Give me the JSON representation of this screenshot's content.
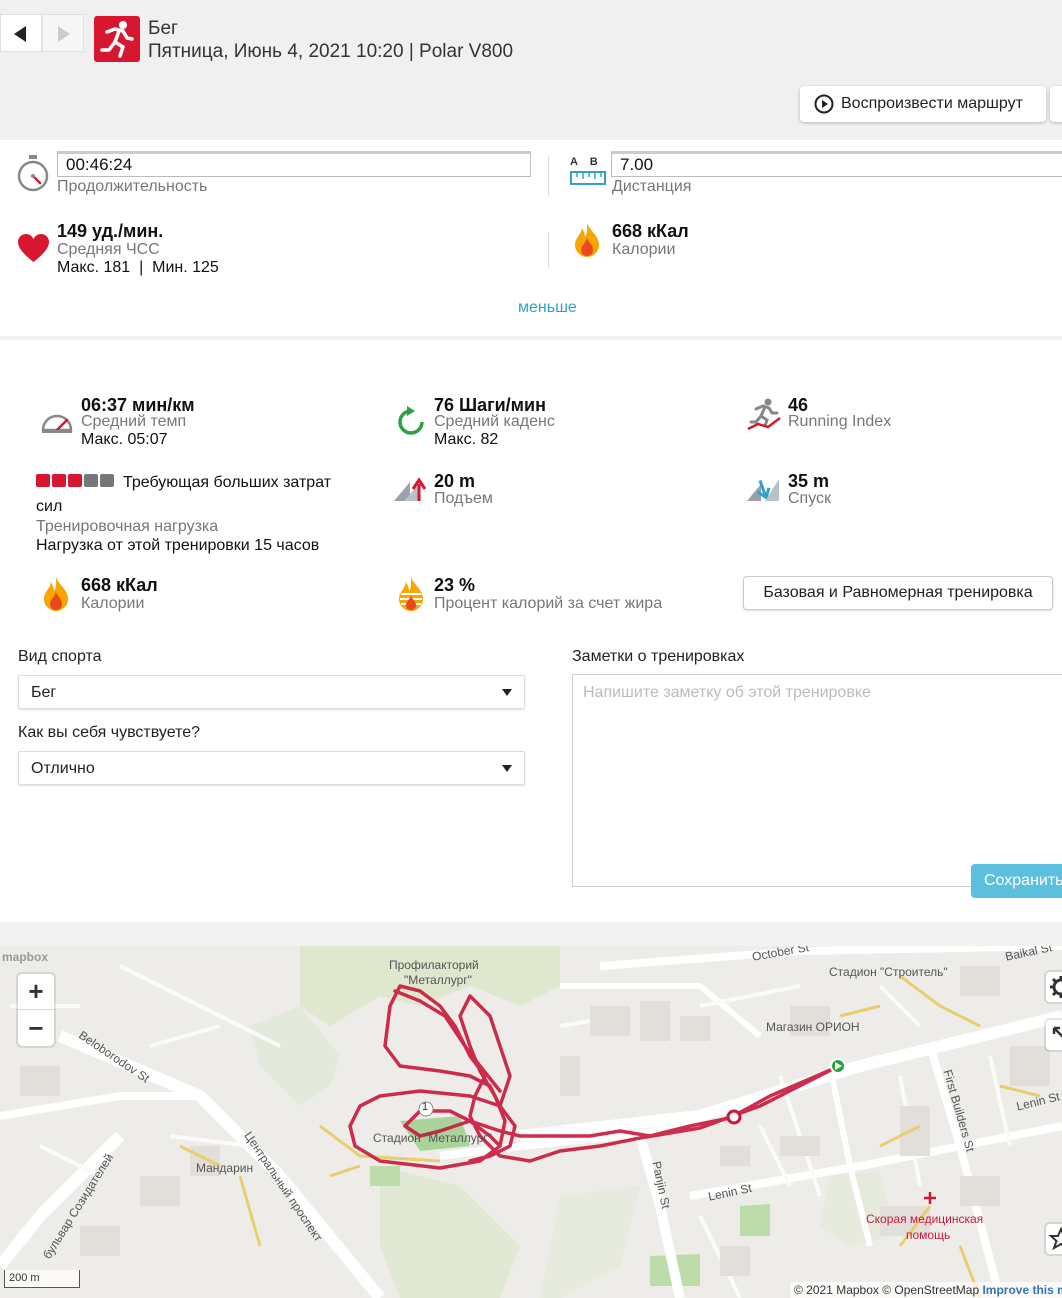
{
  "header": {
    "sport": "Бег",
    "subtitle": "Пятница, Июнь 4, 2021 10:20 | Polar V800",
    "replay_label": "Воспроизвести маршрут"
  },
  "summary": {
    "duration_value": "00:46:24",
    "duration_label": "Продолжительность",
    "distance_icon_text": "A    B",
    "distance_value": "7.00",
    "distance_label": "Дистанция",
    "hr_value": "149 уд./мин.",
    "hr_label": "Средняя ЧСС",
    "hr_minmax": "Макс. 181  |  Мин. 125",
    "calories_value": "668 кКал",
    "calories_label": "Калории",
    "less_link": "меньше"
  },
  "stats": {
    "pace_value": "06:37 мин/км",
    "pace_label": "Средний темп",
    "pace_max": "Макс. 05:07",
    "cadence_value": "76 Шаги/мин",
    "cadence_label": "Средний каденс",
    "cadence_max": "Макс. 82",
    "running_index_value": "46",
    "running_index_label": "Running Index",
    "load_level_filled": 3,
    "load_level_total": 5,
    "load_title_line1": "Требующая больших затрат",
    "load_title_line2": "сил",
    "load_label": "Тренировочная нагрузка",
    "load_recovery": "Нагрузка от этой тренировки 15 часов",
    "ascent_value": "20 m",
    "ascent_label": "Подъем",
    "descent_value": "35 m",
    "descent_label": "Спуск",
    "calories_value": "668 кКал",
    "calories_label": "Калории",
    "fat_value": "23 %",
    "fat_label": "Процент калорий за счет жира",
    "training_benefit": "Базовая и Равномерная тренировка"
  },
  "form": {
    "sport_label": "Вид спорта",
    "sport_value": "Бег",
    "feeling_label": "Как вы себя чувствуете?",
    "feeling_value": "Отлично",
    "notes_label": "Заметки о тренировках",
    "notes_placeholder": "Напишите заметку об этой тренировке",
    "save_label": "Сохранить"
  },
  "map": {
    "mapbox_logo": "mapbox",
    "zoom_in": "+",
    "zoom_out": "−",
    "scale": "200 m",
    "attribution": "© 2021 Mapbox © OpenStreetMap",
    "improve": "Improve this map",
    "labels": {
      "profilaktory1": "Профилакторий",
      "profilaktory2": "\"Металлург\"",
      "stadium_builder": "Стадион \"Строитель\"",
      "shop_orion": "Магазин ОРИОН",
      "stadium_metallurg": "Стадион \"Металлург\"",
      "mandarin": "Мандарин",
      "central_prospect": "Центральный проспект",
      "sozidateley": "бульвар Созидателей",
      "beloborodov": "Beloborodov St",
      "october": "October St",
      "baikal": "Baikal St",
      "lenin_st1": "Lenin St",
      "lenin_st2": "Lenin St",
      "first_builders": "First Builders St",
      "panjin": "Panjin St",
      "ambulance1": "Скорая медицинская",
      "ambulance2": "помощь",
      "lap_marker": "1"
    }
  },
  "colors": {
    "accent_red": "#d7172f",
    "link_blue": "#2ea3c9",
    "save_button": "#5bc0de",
    "route": "#c8183c"
  }
}
